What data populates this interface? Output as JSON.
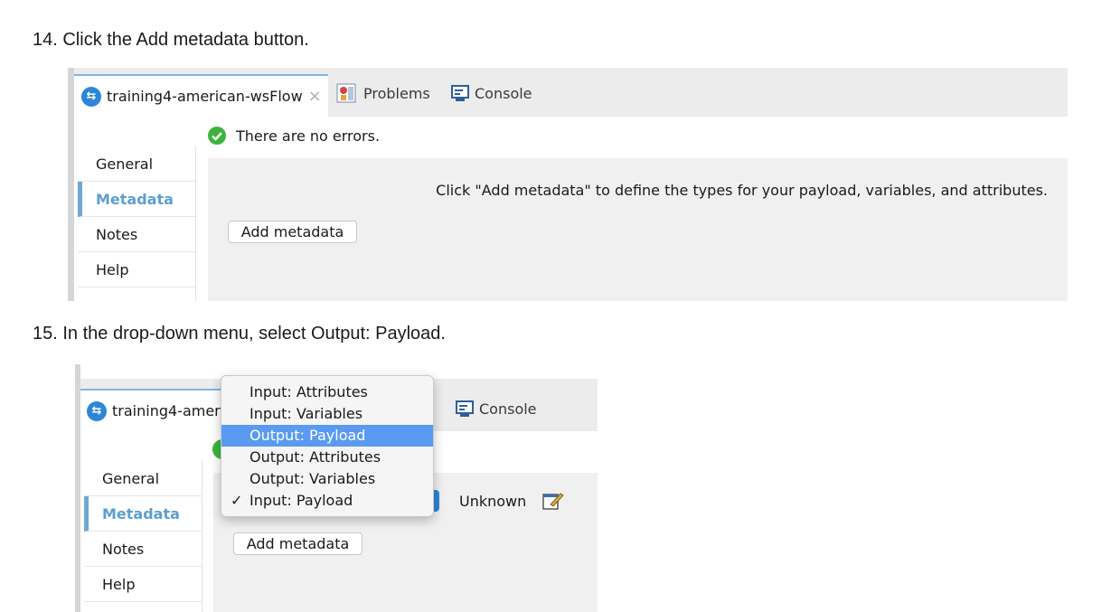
{
  "steps": [
    {
      "text": "14. Click the Add metadata button."
    },
    {
      "text": "15. In the drop-down menu, select Output: Payload."
    }
  ],
  "shot1": {
    "tab_flow": "training4-american-wsFlow",
    "tab_close_glyph": "×",
    "tab_problems": "Problems",
    "tab_console": "Console",
    "status_text": "There are no errors.",
    "sidebar": [
      "General",
      "Metadata",
      "Notes",
      "Help"
    ],
    "selected_sidebar": "Metadata",
    "hint_text": "Click \"Add metadata\" to define the types for your payload, variables, and attributes.",
    "add_button": "Add metadata"
  },
  "shot2": {
    "tab_flow_partial": "training4-ameri",
    "tab_console": "Console",
    "sidebar": [
      "General",
      "Metadata",
      "Notes",
      "Help"
    ],
    "selected_sidebar": "Metadata",
    "type_value": "Unknown",
    "add_button": "Add metadata",
    "menu": {
      "items": [
        "Input: Attributes",
        "Input: Variables",
        "Output: Payload",
        "Output: Attributes",
        "Output: Variables",
        "Input: Payload"
      ],
      "highlighted": "Output: Payload",
      "checked": "Input: Payload",
      "check_glyph": "✓"
    }
  },
  "colors": {
    "accent_blue": "#5c9fd0",
    "menu_highlight": "#5a9af0",
    "flow_icon": "#2d86d8",
    "ok_green": "#3cb43c"
  }
}
